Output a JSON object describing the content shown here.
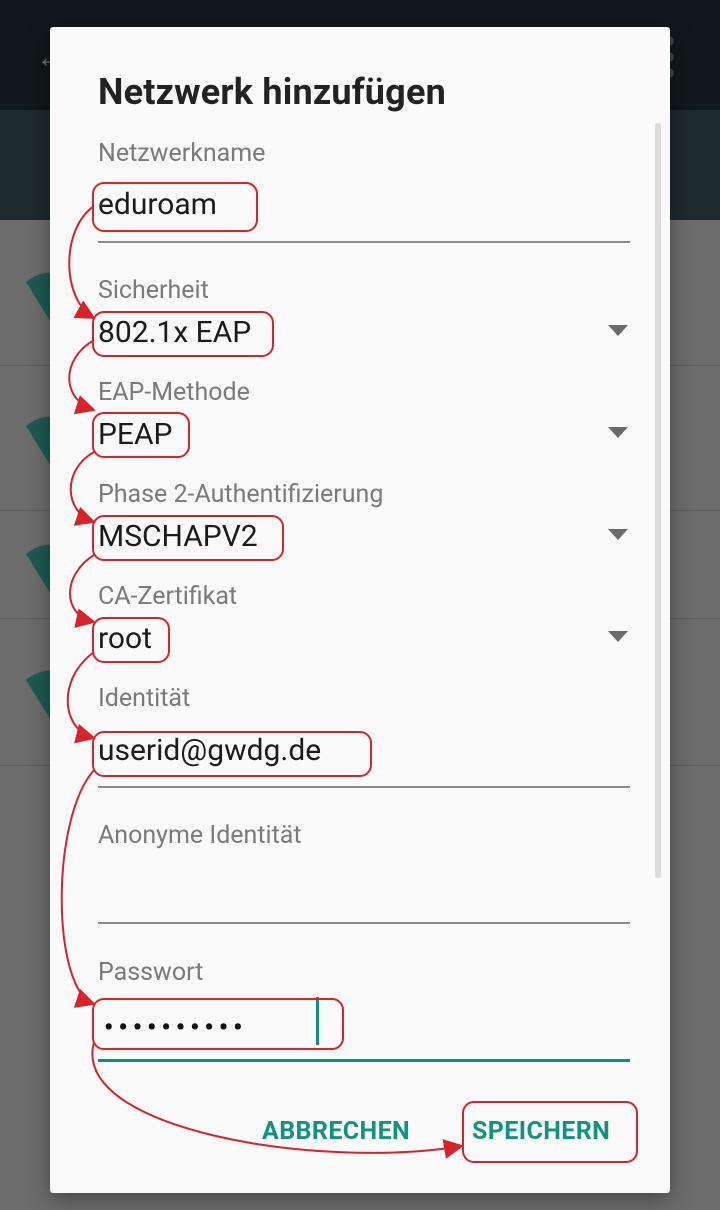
{
  "dialog": {
    "title": "Netzwerk hinzufügen",
    "network_name": {
      "label": "Netzwerkname",
      "value": "eduroam"
    },
    "security": {
      "label": "Sicherheit",
      "value": "802.1x EAP"
    },
    "eap_method": {
      "label": "EAP-Methode",
      "value": "PEAP"
    },
    "phase2": {
      "label": "Phase 2-Authentifizierung",
      "value": "MSCHAPV2"
    },
    "ca_cert": {
      "label": "CA-Zertifikat",
      "value": "root"
    },
    "identity": {
      "label": "Identität",
      "value": "userid@gwdg.de"
    },
    "anon_identity": {
      "label": "Anonyme Identität",
      "value": ""
    },
    "password": {
      "label": "Passwort",
      "value": "••••••••••"
    },
    "cancel_label": "ABBRECHEN",
    "save_label": "SPEICHERN"
  },
  "colors": {
    "accent": "#129382",
    "annotation": "#d8232a"
  },
  "icons": [
    "wifi-icon",
    "back-arrow-icon",
    "overflow-menu-icon",
    "dropdown-caret-icon"
  ]
}
